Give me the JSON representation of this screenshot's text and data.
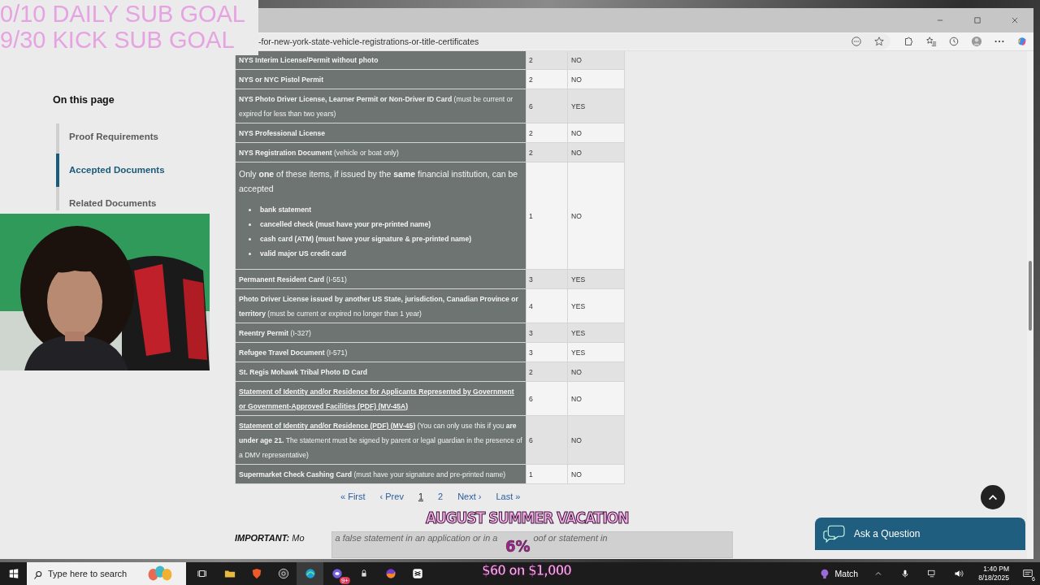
{
  "overlay_goals": [
    "0/10 DAILY SUB GOAL",
    "9/30 KICK SUB GOAL"
  ],
  "browser": {
    "url": "-for-new-york-state-vehicle-registrations-or-title-certificates"
  },
  "sidebar": {
    "title": "On this page",
    "items": [
      {
        "label": "Proof Requirements",
        "selected": false
      },
      {
        "label": "Accepted Documents",
        "selected": true
      },
      {
        "label": "Related Documents",
        "selected": false
      }
    ]
  },
  "table": {
    "rows": [
      {
        "kind": "doc",
        "name": "NYS Interim License/Permit without photo",
        "points": "2",
        "usable": "NO",
        "link": false
      },
      {
        "kind": "doc",
        "name": "NYS or NYC Pistol Permit",
        "points": "2",
        "usable": "NO",
        "link": false
      },
      {
        "kind": "doc",
        "name": "NYS Photo Driver License, Learner Permit or Non-Driver ID Card",
        "note": "(must be current or expired for less than two years)",
        "points": "6",
        "usable": "YES",
        "link": false
      },
      {
        "kind": "doc",
        "name": "NYS Professional License",
        "points": "2",
        "usable": "NO",
        "link": false
      },
      {
        "kind": "doc",
        "name": "NYS Registration Document",
        "note": "(vehicle or boat only)",
        "points": "2",
        "usable": "NO",
        "link": false
      },
      {
        "kind": "list",
        "intro": "Only **one** of these items, if issued by the **same** financial institution, can be accepted",
        "items": [
          "bank statement",
          "cancelled check (must have your pre-printed name)",
          "cash card (ATM) (must have your signature & pre-printed name)",
          "valid major US credit card"
        ],
        "points": "1",
        "usable": "NO"
      },
      {
        "kind": "doc",
        "name": "Permanent Resident Card",
        "note": "(I-551)",
        "points": "3",
        "usable": "YES",
        "link": false
      },
      {
        "kind": "doc",
        "name": "Photo Driver License issued by another US State, jurisdiction, Canadian Province or territory",
        "note": "(must be current or expired no longer than 1 year)",
        "points": "4",
        "usable": "YES",
        "link": false
      },
      {
        "kind": "doc",
        "name": "Reentry Permit",
        "note": "(I-327)",
        "points": "3",
        "usable": "YES",
        "link": false
      },
      {
        "kind": "doc",
        "name": "Refugee Travel Document",
        "note": "(I-571)",
        "points": "3",
        "usable": "YES",
        "link": false
      },
      {
        "kind": "doc",
        "name": "St. Regis Mohawk Tribal Photo ID Card",
        "points": "2",
        "usable": "NO",
        "link": false
      },
      {
        "kind": "doc",
        "name": "Statement of Identity and/or Residence for Applicants Represented by Government or Government-Approved Facilities (PDF) (MV-45A)",
        "points": "6",
        "usable": "NO",
        "link": true
      },
      {
        "kind": "doc",
        "name": "Statement of Identity and/or Residence (PDF) (MV-45)",
        "note": "(You can only use this if you **are under age 21.** The statement must be signed by parent or legal guardian in the presence of a DMV representative)",
        "points": "6",
        "usable": "NO",
        "link": true
      },
      {
        "kind": "doc",
        "name": "Supermarket Check Cashing Card",
        "note": "(must have your signature and pre-printed name)",
        "points": "1",
        "usable": "NO",
        "link": false
      }
    ]
  },
  "pagination": [
    {
      "label": "« First",
      "selected": false
    },
    {
      "label": "‹ Prev",
      "selected": false
    },
    {
      "label": "1",
      "selected": true
    },
    {
      "label": "2",
      "selected": false
    },
    {
      "label": "Next ›",
      "selected": false
    },
    {
      "label": "Last »",
      "selected": false
    }
  ],
  "important": {
    "label": "IMPORTANT:",
    "fragments": [
      "Mo",
      "a false statement in an application or in a",
      "oof or statement in"
    ]
  },
  "ask_question": "Ask a Question",
  "goal_widget": {
    "title": "AUGUST SUMMER VACATION",
    "percent": "6%",
    "amount": "$60 on $1,000"
  },
  "taskbar": {
    "search_placeholder": "Type here to search",
    "badge": "9+",
    "weather": "Match",
    "time": "1:40 PM",
    "date": "8/18/2025",
    "notifications": "6"
  }
}
